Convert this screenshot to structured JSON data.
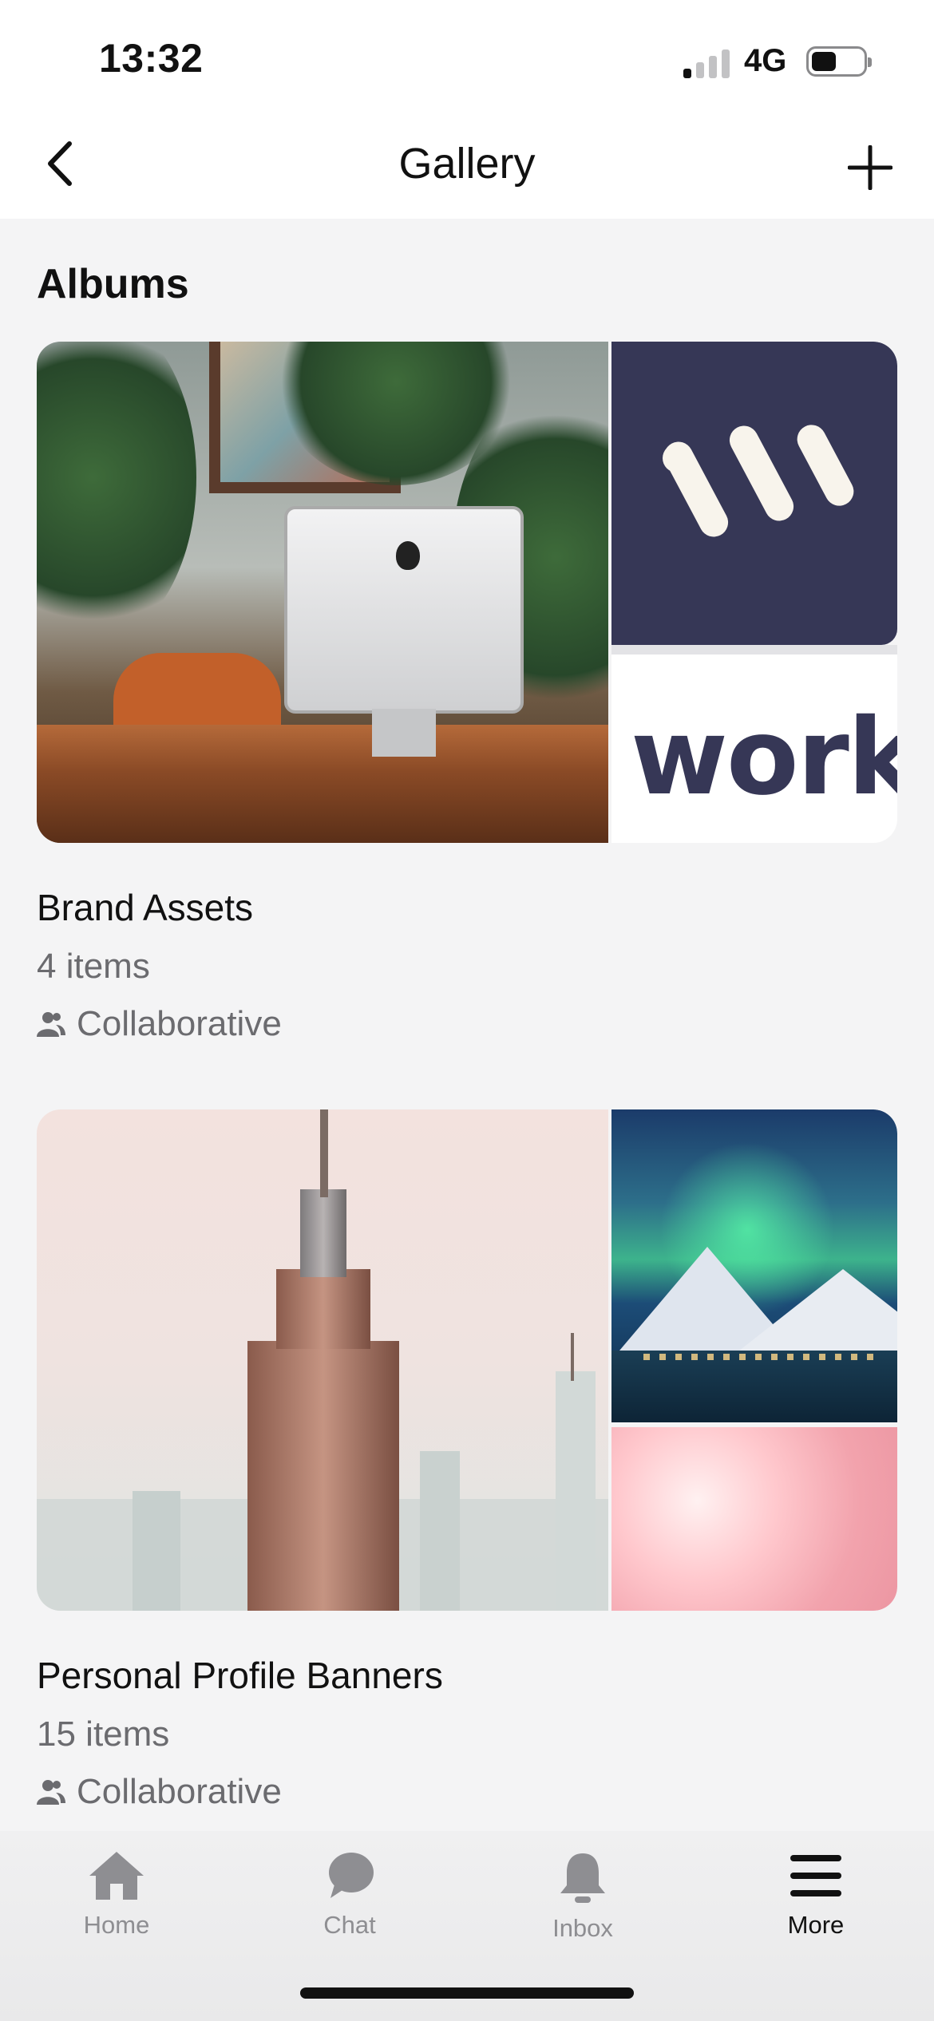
{
  "status_bar": {
    "time": "13:32",
    "network": "4G",
    "signal_bars_active": 1,
    "battery_level": 0.45
  },
  "nav": {
    "title": "Gallery",
    "back_icon": "chevron-left-icon",
    "add_icon": "plus-icon"
  },
  "section": {
    "title": "Albums"
  },
  "albums": [
    {
      "name": "Brand Assets",
      "count": "4 items",
      "type": "Collaborative",
      "brand_word": "workv"
    },
    {
      "name": "Personal Profile Banners",
      "count": "15 items",
      "type": "Collaborative"
    }
  ],
  "tab_bar": {
    "tabs": [
      {
        "label": "Home",
        "icon": "home-icon",
        "active": false
      },
      {
        "label": "Chat",
        "icon": "chat-bubble-icon",
        "active": false
      },
      {
        "label": "Inbox",
        "icon": "bell-icon",
        "active": false
      },
      {
        "label": "More",
        "icon": "menu-icon",
        "active": true
      }
    ]
  },
  "colors": {
    "accent_navy": "#363756",
    "background": "#f4f4f5",
    "muted_text": "#6b6b6f",
    "inactive_tab": "#8e8e92"
  }
}
